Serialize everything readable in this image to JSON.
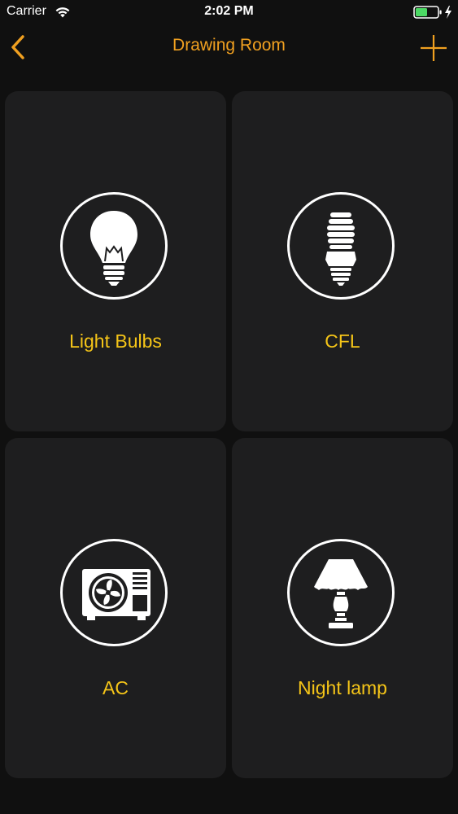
{
  "status_bar": {
    "carrier": "Carrier",
    "time": "2:02 PM",
    "battery_color": "#4cd964"
  },
  "nav": {
    "title": "Drawing Room",
    "back_icon": "chevron-left-icon",
    "add_icon": "plus-icon",
    "accent_color": "#f0a020"
  },
  "devices": [
    {
      "label": "Light Bulbs",
      "icon": "light-bulb-icon"
    },
    {
      "label": "CFL",
      "icon": "cfl-bulb-icon"
    },
    {
      "label": "AC",
      "icon": "air-conditioner-icon"
    },
    {
      "label": "Night lamp",
      "icon": "night-lamp-icon"
    }
  ],
  "label_color": "#f5c518"
}
